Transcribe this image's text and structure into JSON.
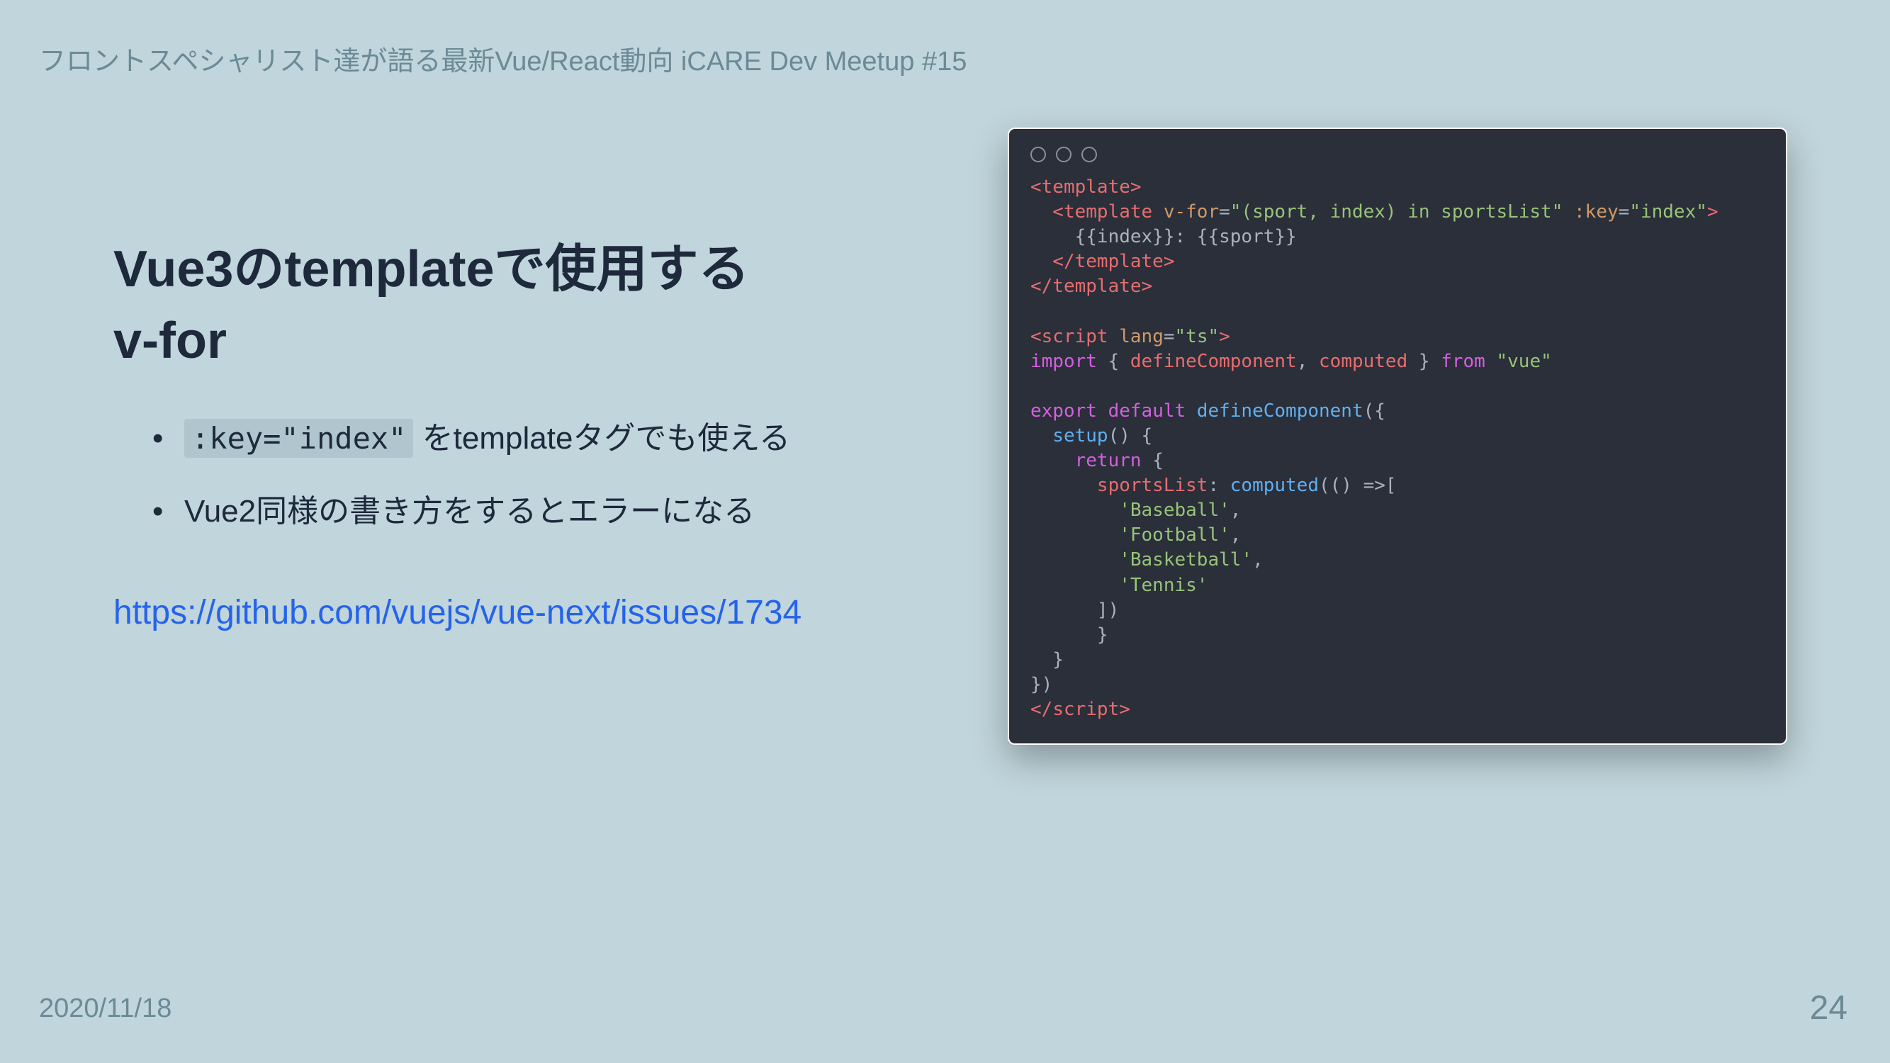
{
  "header": "フロントスペシャリスト達が語る最新Vue/React動向 iCARE Dev Meetup #15",
  "title": "Vue3のtemplateで使用する\nv-for",
  "bullets": {
    "item1_code": ":key=\"index\"",
    "item1_text_after": " をtemplateタグでも使える",
    "item2": "Vue2同様の書き方をするとエラーになる"
  },
  "link": "https://github.com/vuejs/vue-next/issues/1734",
  "code": {
    "line1_tag": "<template>",
    "line2_tag_open": "  <template",
    "line2_attr1": " v-for",
    "line2_eq1": "=",
    "line2_val1": "\"(sport, index) in sportsList\"",
    "line2_attr2": " :key",
    "line2_eq2": "=",
    "line2_val2": "\"index\"",
    "line2_close": ">",
    "line3": "    {{index}}: {{sport}}",
    "line4": "  </template>",
    "line5": "</template>",
    "line7_open": "<script",
    "line7_attr": " lang",
    "line7_eq": "=",
    "line7_val": "\"ts\"",
    "line7_close": ">",
    "line8_import": "import",
    "line8_brace1": " { ",
    "line8_names": "defineComponent",
    "line8_comma": ", ",
    "line8_names2": "computed",
    "line8_brace2": " } ",
    "line8_from": "from",
    "line8_mod": " \"vue\"",
    "line10_export": "export",
    "line10_default": " default",
    "line10_fn": " defineComponent",
    "line10_paren": "({",
    "line11_setup": "  setup",
    "line11_paren": "() {",
    "line12_return": "    return",
    "line12_brace": " {",
    "line13_name": "      sportsList",
    "line13_colon": ": ",
    "line13_fn": "computed",
    "line13_arrow": "(() =>",
    "line13_bracket": "[",
    "line14": "        'Baseball'",
    "line14_comma": ",",
    "line15": "        'Football'",
    "line15_comma": ",",
    "line16": "        'Basketball'",
    "line16_comma": ",",
    "line17": "        'Tennis'",
    "line18": "      ])",
    "line19": "      }",
    "line20": "  }",
    "line21": "})",
    "line22_open": "</",
    "line22_tag": "script",
    "line22_close": ">"
  },
  "footer": {
    "date": "2020/11/18",
    "page": "24"
  }
}
